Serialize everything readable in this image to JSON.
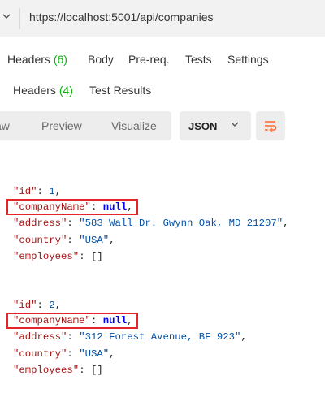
{
  "request": {
    "url": "https://localhost:5001/api/companies",
    "tabs": [
      {
        "label": "Headers",
        "count": "(6)"
      },
      {
        "label": "Body"
      },
      {
        "label": "Pre-req."
      },
      {
        "label": "Tests"
      },
      {
        "label": "Settings"
      }
    ]
  },
  "response": {
    "tabs": [
      {
        "label": "Headers",
        "count": "(4)"
      },
      {
        "label": "Test Results"
      }
    ],
    "view_modes": [
      "aw",
      "Preview",
      "Visualize"
    ],
    "format": "JSON",
    "records": [
      {
        "id_key": "\"id\"",
        "id_value": "1",
        "name_key": "\"companyName\"",
        "name_value": "null",
        "address_key": "\"address\"",
        "address_value": "\"583 Wall Dr. Gwynn Oak, MD 21207\"",
        "country_key": "\"country\"",
        "country_value": "\"USA\"",
        "employees_key": "\"employees\"",
        "employees_value": "[]"
      },
      {
        "id_key": "\"id\"",
        "id_value": "2",
        "name_key": "\"companyName\"",
        "name_value": "null",
        "address_key": "\"address\"",
        "address_value": "\"312 Forest Avenue, BF 923\"",
        "country_key": "\"country\"",
        "country_value": "\"USA\"",
        "employees_key": "\"employees\"",
        "employees_value": "[]"
      }
    ]
  },
  "colors": {
    "accent_green": "#0cb20c",
    "highlight_red": "#e8242b",
    "json_key": "#a31515",
    "json_string": "#0451a5",
    "json_null": "#0000ff"
  },
  "icons": [
    "chevron-down-icon",
    "wrap-lines-icon"
  ]
}
